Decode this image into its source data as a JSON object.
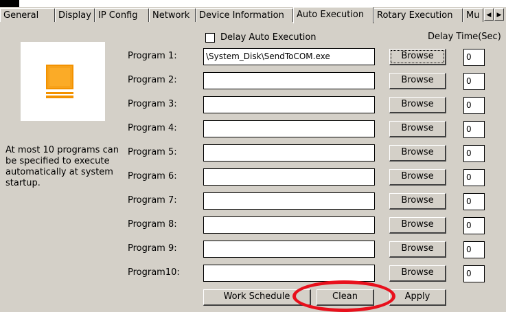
{
  "tabs": [
    {
      "label": "General"
    },
    {
      "label": "Display"
    },
    {
      "label": "IP Config"
    },
    {
      "label": "Network"
    },
    {
      "label": "Device Information"
    },
    {
      "label": "Auto Execution",
      "active": true
    },
    {
      "label": "Rotary Execution"
    },
    {
      "label": "Mu"
    }
  ],
  "description": "At most 10 programs can be specified to execute automatically at system startup.",
  "delay_auto_execution": {
    "label": "Delay Auto Execution",
    "checked": false
  },
  "delay_header": "Delay Time(Sec)",
  "browse_label": "Browse",
  "programs": [
    {
      "label": "Program 1:",
      "path": "\\System_Disk\\SendToCOM.exe",
      "delay": "0"
    },
    {
      "label": "Program 2:",
      "path": "",
      "delay": "0"
    },
    {
      "label": "Program 3:",
      "path": "",
      "delay": "0"
    },
    {
      "label": "Program 4:",
      "path": "",
      "delay": "0"
    },
    {
      "label": "Program 5:",
      "path": "",
      "delay": "0"
    },
    {
      "label": "Program 6:",
      "path": "",
      "delay": "0"
    },
    {
      "label": "Program 7:",
      "path": "",
      "delay": "0"
    },
    {
      "label": "Program 8:",
      "path": "",
      "delay": "0"
    },
    {
      "label": "Program 9:",
      "path": "",
      "delay": "0"
    },
    {
      "label": "Program10:",
      "path": "",
      "delay": "0"
    }
  ],
  "buttons": {
    "work_schedule": "Work Schedule",
    "clean": "Clean",
    "apply": "Apply"
  },
  "icons": {
    "illustration": "computer-monitor-icon",
    "scroll_left": "chevron-left-icon",
    "scroll_right": "chevron-right-icon"
  },
  "colors": {
    "background": "#d4d0c8",
    "illustration_accent": "#f39200",
    "highlight": "#e8101c"
  }
}
